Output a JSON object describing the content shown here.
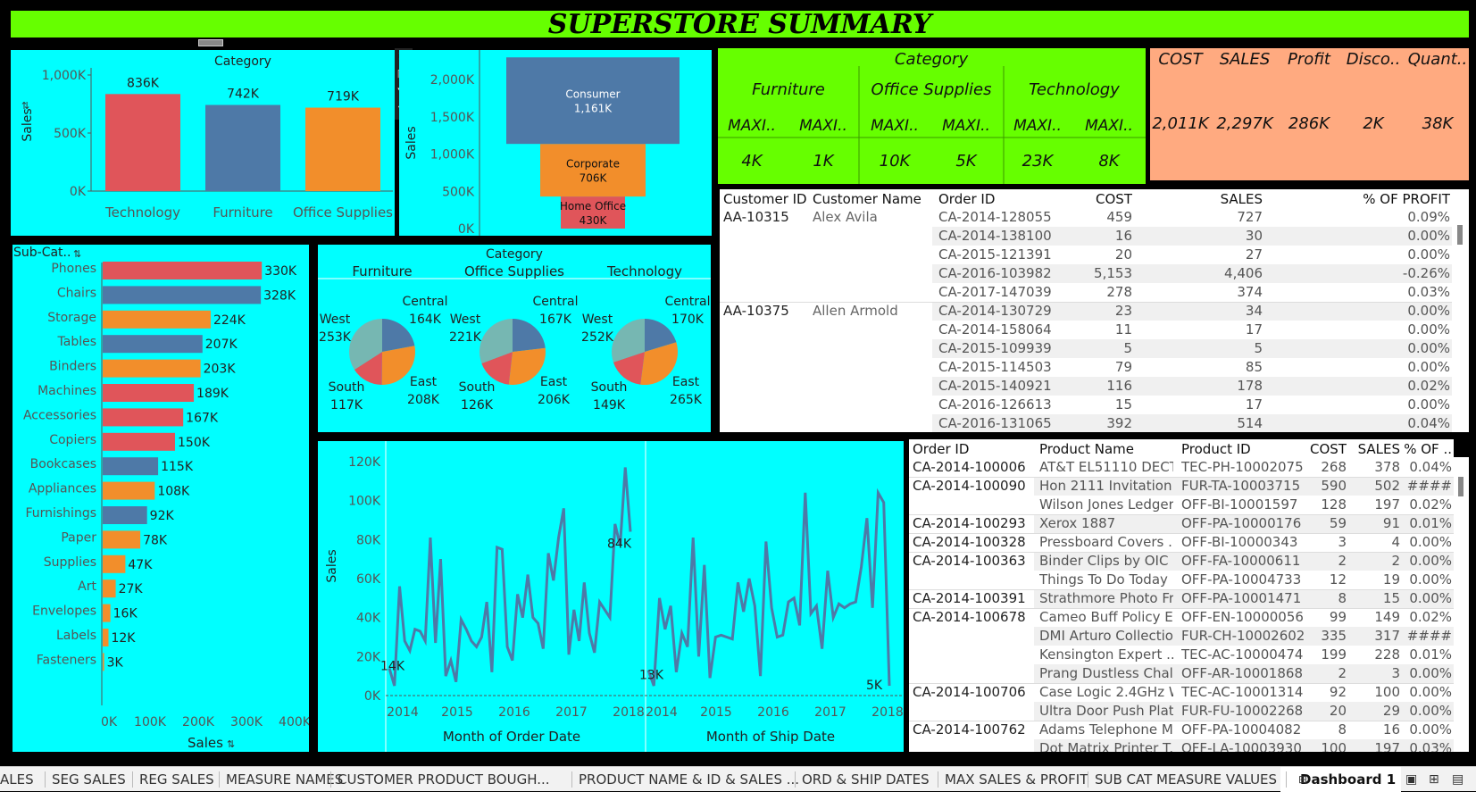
{
  "title": "SUPERSTORE SUMMARY",
  "colors": {
    "red": "#e0555a",
    "blue": "#4e79a7",
    "orange": "#f28e2b",
    "teal": "#76b7b2",
    "cyan": "#00ffff",
    "green": "#66ff00",
    "salmon": "#ffaa80"
  },
  "category_bar": {
    "title": "Category",
    "ylabel": "Sales",
    "categories": [
      "Technology",
      "Furniture",
      "Office Supplies"
    ],
    "values": [
      836,
      742,
      719
    ],
    "labels": [
      "836K",
      "742K",
      "719K"
    ],
    "ticks": [
      "1,000K",
      "500K",
      "0K"
    ],
    "ylim": [
      0,
      1000
    ]
  },
  "segment_funnel": {
    "ylabel": "Sales",
    "segments": [
      {
        "name": "Consumer",
        "value": "1,161K",
        "sales": 1161
      },
      {
        "name": "Corporate",
        "value": "706K",
        "sales": 706
      },
      {
        "name": "Home Office",
        "value": "430K",
        "sales": 430
      }
    ],
    "ticks": [
      "2,000K",
      "1,500K",
      "1,000K",
      "500K",
      "0K"
    ]
  },
  "category_kpi": {
    "header": "Category",
    "categories": [
      "Furniture",
      "Office Supplies",
      "Technology"
    ],
    "measure_labels": [
      "MAXI..",
      "MAXI..",
      "MAXI..",
      "MAXI..",
      "MAXI..",
      "MAXI.."
    ],
    "values": [
      "4K",
      "1K",
      "10K",
      "5K",
      "23K",
      "8K"
    ]
  },
  "totals_kpi": {
    "labels": [
      "COST",
      "SALES",
      "Profit",
      "Disco..",
      "Quant.."
    ],
    "values": [
      "2,011K",
      "2,297K",
      "286K",
      "2K",
      "38K"
    ]
  },
  "customer_table": {
    "headers": [
      "Customer ID",
      "Customer Name",
      "Order ID",
      "COST",
      "SALES",
      "% OF PROFIT"
    ],
    "rows": [
      [
        "AA-10315",
        "Alex Avila",
        "CA-2014-128055",
        "459",
        "727",
        "0.09%"
      ],
      [
        "",
        "",
        "CA-2014-138100",
        "16",
        "30",
        "0.00%"
      ],
      [
        "",
        "",
        "CA-2015-121391",
        "20",
        "27",
        "0.00%"
      ],
      [
        "",
        "",
        "CA-2016-103982",
        "5,153",
        "4,406",
        "-0.26%"
      ],
      [
        "",
        "",
        "CA-2017-147039",
        "278",
        "374",
        "0.03%"
      ],
      [
        "AA-10375",
        "Allen Armold",
        "CA-2014-130729",
        "23",
        "34",
        "0.00%"
      ],
      [
        "",
        "",
        "CA-2014-158064",
        "11",
        "17",
        "0.00%"
      ],
      [
        "",
        "",
        "CA-2015-109939",
        "5",
        "5",
        "0.00%"
      ],
      [
        "",
        "",
        "CA-2015-114503",
        "79",
        "85",
        "0.00%"
      ],
      [
        "",
        "",
        "CA-2015-140921",
        "116",
        "178",
        "0.02%"
      ],
      [
        "",
        "",
        "CA-2016-126613",
        "15",
        "17",
        "0.00%"
      ],
      [
        "",
        "",
        "CA-2016-131065",
        "392",
        "514",
        "0.04%"
      ]
    ]
  },
  "subcat_bar": {
    "header": "Sub-Cat..",
    "xlabel": "Sales",
    "items": [
      {
        "name": "Phones",
        "value": 330,
        "label": "330K",
        "cat": "red"
      },
      {
        "name": "Chairs",
        "value": 328,
        "label": "328K",
        "cat": "blue"
      },
      {
        "name": "Storage",
        "value": 224,
        "label": "224K",
        "cat": "orange"
      },
      {
        "name": "Tables",
        "value": 207,
        "label": "207K",
        "cat": "blue"
      },
      {
        "name": "Binders",
        "value": 203,
        "label": "203K",
        "cat": "orange"
      },
      {
        "name": "Machines",
        "value": 189,
        "label": "189K",
        "cat": "red"
      },
      {
        "name": "Accessories",
        "value": 167,
        "label": "167K",
        "cat": "red"
      },
      {
        "name": "Copiers",
        "value": 150,
        "label": "150K",
        "cat": "red"
      },
      {
        "name": "Bookcases",
        "value": 115,
        "label": "115K",
        "cat": "blue"
      },
      {
        "name": "Appliances",
        "value": 108,
        "label": "108K",
        "cat": "orange"
      },
      {
        "name": "Furnishings",
        "value": 92,
        "label": "92K",
        "cat": "blue"
      },
      {
        "name": "Paper",
        "value": 78,
        "label": "78K",
        "cat": "orange"
      },
      {
        "name": "Supplies",
        "value": 47,
        "label": "47K",
        "cat": "orange"
      },
      {
        "name": "Art",
        "value": 27,
        "label": "27K",
        "cat": "orange"
      },
      {
        "name": "Envelopes",
        "value": 16,
        "label": "16K",
        "cat": "orange"
      },
      {
        "name": "Labels",
        "value": 12,
        "label": "12K",
        "cat": "orange"
      },
      {
        "name": "Fasteners",
        "value": 3,
        "label": "3K",
        "cat": "orange"
      }
    ],
    "ticks": [
      "0K",
      "100K",
      "200K",
      "300K",
      "400K"
    ],
    "xlim": [
      0,
      400
    ]
  },
  "region_pies": {
    "header": "Category",
    "pies": [
      {
        "category": "Furniture",
        "regions": [
          {
            "name": "Central",
            "value": "164K",
            "sales": 164
          },
          {
            "name": "East",
            "value": "208K",
            "sales": 208
          },
          {
            "name": "South",
            "value": "117K",
            "sales": 117
          },
          {
            "name": "West",
            "value": "253K",
            "sales": 253
          }
        ]
      },
      {
        "category": "Office Supplies",
        "regions": [
          {
            "name": "Central",
            "value": "167K",
            "sales": 167
          },
          {
            "name": "East",
            "value": "206K",
            "sales": 206
          },
          {
            "name": "South",
            "value": "126K",
            "sales": 126
          },
          {
            "name": "West",
            "value": "221K",
            "sales": 221
          }
        ]
      },
      {
        "category": "Technology",
        "regions": [
          {
            "name": "Central",
            "value": "170K",
            "sales": 170
          },
          {
            "name": "East",
            "value": "265K",
            "sales": 265
          },
          {
            "name": "South",
            "value": "149K",
            "sales": 149
          },
          {
            "name": "West",
            "value": "252K",
            "sales": 252
          }
        ]
      }
    ]
  },
  "chart_data": [
    {
      "type": "bar",
      "title": "Category",
      "categories": [
        "Technology",
        "Furniture",
        "Office Supplies"
      ],
      "values": [
        836000,
        742000,
        719000
      ],
      "ylabel": "Sales",
      "ylim": [
        0,
        1000000
      ]
    },
    {
      "type": "bar",
      "categories": [
        "Consumer",
        "Corporate",
        "Home Office"
      ],
      "values": [
        1161000,
        706000,
        430000
      ],
      "ylabel": "Sales",
      "ylim": [
        0,
        2300000
      ]
    },
    {
      "type": "bar",
      "categories": [
        "Phones",
        "Chairs",
        "Storage",
        "Tables",
        "Binders",
        "Machines",
        "Accessories",
        "Copiers",
        "Bookcases",
        "Appliances",
        "Furnishings",
        "Paper",
        "Supplies",
        "Art",
        "Envelopes",
        "Labels",
        "Fasteners"
      ],
      "values": [
        330000,
        328000,
        224000,
        207000,
        203000,
        189000,
        167000,
        150000,
        115000,
        108000,
        92000,
        78000,
        47000,
        27000,
        16000,
        12000,
        3000
      ],
      "xlabel": "Sales",
      "xlim": [
        0,
        400000
      ]
    },
    {
      "type": "pie",
      "title": "Category",
      "series": [
        {
          "name": "Furniture",
          "categories": [
            "Central",
            "East",
            "South",
            "West"
          ],
          "values": [
            164000,
            208000,
            117000,
            253000
          ]
        },
        {
          "name": "Office Supplies",
          "categories": [
            "Central",
            "East",
            "South",
            "West"
          ],
          "values": [
            167000,
            206000,
            126000,
            221000
          ]
        },
        {
          "name": "Technology",
          "categories": [
            "Central",
            "East",
            "South",
            "West"
          ],
          "values": [
            170000,
            265000,
            149000,
            252000
          ]
        }
      ]
    },
    {
      "type": "line",
      "xlabel": "Month of Order Date",
      "ylabel": "Sales",
      "ylim": [
        0,
        120000
      ],
      "x_ticks": [
        "2014",
        "2015",
        "2016",
        "2017",
        "2018"
      ],
      "y_ticks": [
        "120K",
        "100K",
        "80K",
        "60K",
        "40K",
        "20K",
        "0K"
      ],
      "first_label": "14K",
      "last_label": "84K",
      "values": [
        14,
        5,
        56,
        28,
        23,
        34,
        33,
        28,
        81,
        27,
        70,
        10,
        18,
        7,
        39,
        34,
        28,
        25,
        30,
        48,
        12,
        76,
        75,
        25,
        18,
        52,
        40,
        62,
        40,
        37,
        24,
        73,
        59,
        81,
        96,
        21,
        44,
        28,
        58,
        32,
        22,
        48,
        44,
        40,
        88,
        77,
        117,
        84
      ]
    },
    {
      "type": "line",
      "xlabel": "Month of Ship Date",
      "ylim": [
        0,
        120000
      ],
      "x_ticks": [
        "2014",
        "2015",
        "2016",
        "2017",
        "2018"
      ],
      "first_label": "13K",
      "last_label": "5K",
      "values": [
        13,
        5,
        50,
        34,
        46,
        12,
        32,
        25,
        81,
        20,
        67,
        9,
        30,
        31,
        30,
        29,
        58,
        43,
        60,
        46,
        10,
        79,
        45,
        30,
        31,
        48,
        50,
        36,
        104,
        42,
        46,
        24,
        64,
        40,
        47,
        45,
        47,
        48,
        66,
        91,
        45,
        104,
        99,
        5
      ]
    }
  ],
  "product_table": {
    "headers": [
      "Order ID",
      "Product Name",
      "Product ID",
      "COST",
      "SALES",
      "% OF .."
    ],
    "rows": [
      [
        "CA-2014-100006",
        "AT&T EL51110 DECT",
        "TEC-PH-10002075",
        "268",
        "378",
        "0.04%"
      ],
      [
        "CA-2014-100090",
        "Hon 2111 Invitation ..",
        "FUR-TA-10003715",
        "590",
        "502",
        "####"
      ],
      [
        "",
        "Wilson Jones Ledger..",
        "OFF-BI-10001597",
        "128",
        "197",
        "0.02%"
      ],
      [
        "CA-2014-100293",
        "Xerox 1887",
        "OFF-PA-10000176",
        "59",
        "91",
        "0.01%"
      ],
      [
        "CA-2014-100328",
        "Pressboard Covers ..",
        "OFF-BI-10000343",
        "3",
        "4",
        "0.00%"
      ],
      [
        "CA-2014-100363",
        "Binder Clips by OIC",
        "OFF-FA-10000611",
        "2",
        "2",
        "0.00%"
      ],
      [
        "",
        "Things To Do Today ..",
        "OFF-PA-10004733",
        "12",
        "19",
        "0.00%"
      ],
      [
        "CA-2014-100391",
        "Strathmore Photo Fr..",
        "OFF-PA-10001471",
        "8",
        "15",
        "0.00%"
      ],
      [
        "CA-2014-100678",
        "Cameo Buff Policy E..",
        "OFF-EN-10000056",
        "99",
        "149",
        "0.02%"
      ],
      [
        "",
        "DMI Arturo Collectio..",
        "FUR-CH-10002602",
        "335",
        "317",
        "####"
      ],
      [
        "",
        "Kensington Expert ..",
        "TEC-AC-10000474",
        "199",
        "228",
        "0.01%"
      ],
      [
        "",
        "Prang Dustless Chal..",
        "OFF-AR-10001868",
        "2",
        "3",
        "0.00%"
      ],
      [
        "CA-2014-100706",
        "Case Logic 2.4GHz W..",
        "TEC-AC-10001314",
        "92",
        "100",
        "0.00%"
      ],
      [
        "",
        "Ultra Door Push Plate",
        "FUR-FU-10002268",
        "20",
        "29",
        "0.00%"
      ],
      [
        "CA-2014-100762",
        "Adams Telephone M..",
        "OFF-PA-10004082",
        "8",
        "16",
        "0.00%"
      ],
      [
        "",
        "Dot Matrix Printer T..",
        "OFF-LA-10003930",
        "100",
        "197",
        "0.03%"
      ]
    ]
  },
  "tabs": [
    "ALES",
    "SEG SALES",
    "REG SALES",
    "MEASURE NAMES",
    "CUSTOMER PRODUCT BOUGH...",
    "PRODUCT NAME & ID & SALES ...",
    "ORD & SHIP DATES",
    "MAX SALES & PROFIT",
    "SUB CAT MEASURE VALUES",
    "Dashboard 1"
  ],
  "toolbar_icons": [
    "close-icon",
    "popout-icon",
    "filter-icon",
    "dropdown-icon"
  ]
}
